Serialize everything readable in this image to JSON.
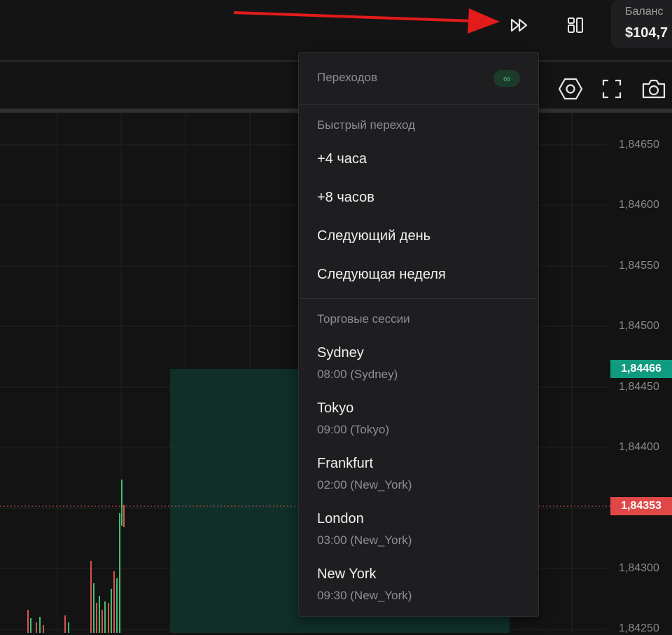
{
  "colors": {
    "background": "#131313",
    "menu_bg": "#1e1e21",
    "accent_green": "#0f9b7f",
    "accent_red": "#e04848",
    "annotation_arrow": "#e31b1b"
  },
  "header": {
    "balance_label": "Баланс",
    "balance_value": "$104,7",
    "fast_forward_icon": "fast-forward-icon",
    "layout_icon": "layout-panels-icon"
  },
  "toolbar": {
    "icons": [
      "settings-hexagon-icon",
      "fullscreen-icon",
      "camera-icon"
    ]
  },
  "chart": {
    "price_labels": [
      "1,84650",
      "1,84600",
      "1,84550",
      "1,84500",
      "1,84450",
      "1,84400",
      "1,84300",
      "1,84250"
    ],
    "current_price_green": "1,84466",
    "current_price_red": "1,84353"
  },
  "menu": {
    "header_label": "Переходов",
    "header_badge": "∞",
    "quick_section_title": "Быстрый переход",
    "quick_items": [
      "+4 часа",
      "+8 часов",
      "Следующий день",
      "Следующая неделя"
    ],
    "sessions_section_title": "Торговые сессии",
    "sessions": [
      {
        "name": "Sydney",
        "time": "08:00 (Sydney)"
      },
      {
        "name": "Tokyo",
        "time": "09:00 (Tokyo)"
      },
      {
        "name": "Frankfurt",
        "time": "02:00 (New_York)"
      },
      {
        "name": "London",
        "time": "03:00 (New_York)"
      },
      {
        "name": "New York",
        "time": "09:30 (New_York)"
      }
    ]
  }
}
